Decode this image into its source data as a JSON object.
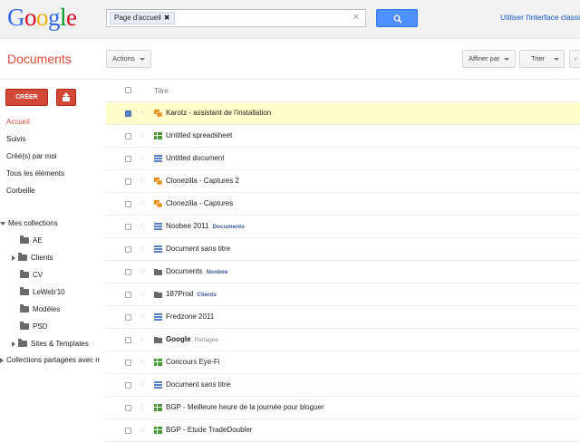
{
  "header": {
    "logo": "Google",
    "search_chip": "Page d'accueil",
    "classic_link": "Utiliser l'interface classique"
  },
  "toolbar": {
    "app_title": "Documents",
    "actions_label": "Actions",
    "affiner_label": "Affiner par",
    "trier_label": "Trier"
  },
  "sidebar": {
    "create_label": "CRÉER",
    "nav": [
      "Accueil",
      "Suivis",
      "Créé(s) par moi",
      "Tous les éléments",
      "Corbeille"
    ],
    "my_collections_label": "Mes collections",
    "collections": [
      "AE",
      "Clients",
      "CV",
      "LeWeb'10",
      "Modèles",
      "PSD",
      "Sites & Templates"
    ],
    "shared_collections_label": "Collections partagées avec moi"
  },
  "list": {
    "header_title": "Titre",
    "rows": [
      {
        "name": "Karotz - assistant de l'installation",
        "tag": "",
        "type": "presentation",
        "selected": true
      },
      {
        "name": "Untitled spreadsheet",
        "tag": "",
        "type": "spreadsheet"
      },
      {
        "name": "Untitled document",
        "tag": "",
        "type": "document"
      },
      {
        "name": "Clonezilla - Captures 2",
        "tag": "",
        "type": "presentation"
      },
      {
        "name": "Clonezilla - Captures",
        "tag": "",
        "type": "presentation"
      },
      {
        "name": "Noobee 2011",
        "tag": "Documents",
        "type": "document"
      },
      {
        "name": "Document sans titre",
        "tag": "",
        "type": "document"
      },
      {
        "name": "Documents",
        "tag": "Noobee",
        "type": "folder"
      },
      {
        "name": "187Prod",
        "tag": "Clients",
        "type": "folder"
      },
      {
        "name": "Fredzone 2011",
        "tag": "",
        "type": "document"
      },
      {
        "name": "Google",
        "tag": "Partagée",
        "type": "shared-folder",
        "bold": true
      },
      {
        "name": "Concours Eye-Fi",
        "tag": "",
        "type": "spreadsheet"
      },
      {
        "name": "Document sans titre",
        "tag": "",
        "type": "document"
      },
      {
        "name": "BGP - Meilleure heure de la journée pour bloguer",
        "tag": "",
        "type": "spreadsheet"
      },
      {
        "name": "BGP - Etude TradeDoubler",
        "tag": "",
        "type": "spreadsheet"
      }
    ]
  },
  "colors": {
    "accent_red": "#dd4b39",
    "search_blue": "#4d90fe",
    "selected_row": "#ffffcc",
    "doc_blue": "#5a7fc4",
    "sheet_green": "#4a9a3a",
    "pres_orange": "#e8901c",
    "folder_grey": "#6a6a6a"
  }
}
